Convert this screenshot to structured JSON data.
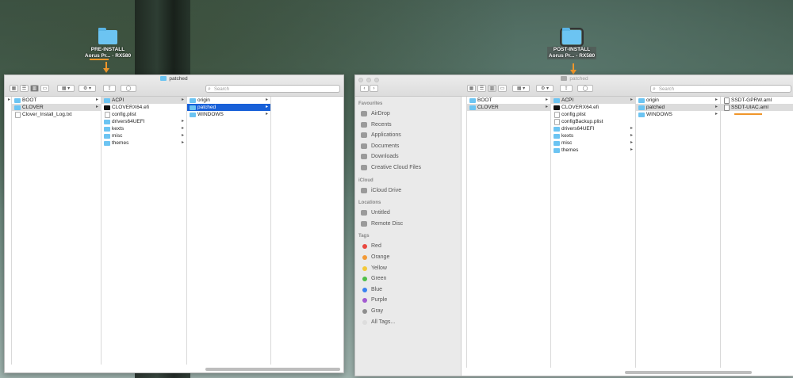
{
  "desktop": {
    "pre_icon": {
      "line1": "PRE-INSTALL",
      "line2": "Aorus Pr... - RX580"
    },
    "post_icon": {
      "line1": "POST-INSTALL",
      "line2": "Aorus Pr... - RX580"
    }
  },
  "left_window": {
    "title": "patched",
    "search_placeholder": "Search",
    "columns": [
      [
        {
          "label": "BOOT",
          "icon": "folder",
          "chev": true
        },
        {
          "label": "CLOVER",
          "icon": "folder",
          "chev": true,
          "state": "hl"
        },
        {
          "label": "Clover_Install_Log.txt",
          "icon": "doc",
          "chev": false
        }
      ],
      [
        {
          "label": "ACPI",
          "icon": "folder",
          "chev": true,
          "state": "hl"
        },
        {
          "label": "CLOVERX64.efi",
          "icon": "black",
          "chev": false
        },
        {
          "label": "config.plist",
          "icon": "doc",
          "chev": false
        },
        {
          "label": "drivers64UEFI",
          "icon": "folder",
          "chev": true
        },
        {
          "label": "kexts",
          "icon": "folder",
          "chev": true
        },
        {
          "label": "misc",
          "icon": "folder",
          "chev": true
        },
        {
          "label": "themes",
          "icon": "folder",
          "chev": true
        }
      ],
      [
        {
          "label": "origin",
          "icon": "folder",
          "chev": true
        },
        {
          "label": "patched",
          "icon": "folder",
          "chev": true,
          "state": "sel"
        },
        {
          "label": "WINDOWS",
          "icon": "folder",
          "chev": true
        }
      ]
    ]
  },
  "right_window": {
    "title": "patched",
    "search_placeholder": "Search",
    "sidebar": {
      "favorites_head": "Favourites",
      "favorites": [
        {
          "label": "AirDrop",
          "icon": "airdrop-icon"
        },
        {
          "label": "Recents",
          "icon": "clock-icon"
        },
        {
          "label": "Applications",
          "icon": "applications-icon"
        },
        {
          "label": "Documents",
          "icon": "documents-icon"
        },
        {
          "label": "Downloads",
          "icon": "downloads-icon"
        },
        {
          "label": "Creative Cloud Files",
          "icon": "folder-icon"
        }
      ],
      "icloud_head": "iCloud",
      "icloud": [
        {
          "label": "iCloud Drive",
          "icon": "cloud-icon"
        }
      ],
      "locations_head": "Locations",
      "locations": [
        {
          "label": "Untitled",
          "icon": "disk-icon"
        },
        {
          "label": "Remote Disc",
          "icon": "disc-icon"
        }
      ],
      "tags_head": "Tags",
      "tags": [
        {
          "label": "Red",
          "color": "#e9483f"
        },
        {
          "label": "Orange",
          "color": "#f39a36"
        },
        {
          "label": "Yellow",
          "color": "#f3c93a"
        },
        {
          "label": "Green",
          "color": "#4fbf4a"
        },
        {
          "label": "Blue",
          "color": "#3a82f0"
        },
        {
          "label": "Purple",
          "color": "#a35ad1"
        },
        {
          "label": "Gray",
          "color": "#8e8e8e"
        },
        {
          "label": "All Tags...",
          "color": "#dddddd"
        }
      ]
    },
    "columns": [
      [
        {
          "label": "BOOT",
          "icon": "folder",
          "chev": true
        },
        {
          "label": "CLOVER",
          "icon": "folder",
          "chev": true,
          "state": "hl"
        }
      ],
      [
        {
          "label": "ACPI",
          "icon": "folder",
          "chev": true,
          "state": "hl"
        },
        {
          "label": "CLOVERX64.efi",
          "icon": "black",
          "chev": false
        },
        {
          "label": "config.plist",
          "icon": "doc",
          "chev": false
        },
        {
          "label": "configBackup.plist",
          "icon": "doc",
          "chev": false
        },
        {
          "label": "drivers64UEFI",
          "icon": "folder",
          "chev": true
        },
        {
          "label": "kexts",
          "icon": "folder",
          "chev": true
        },
        {
          "label": "misc",
          "icon": "folder",
          "chev": true
        },
        {
          "label": "themes",
          "icon": "folder",
          "chev": true
        }
      ],
      [
        {
          "label": "origin",
          "icon": "folder",
          "chev": true
        },
        {
          "label": "patched",
          "icon": "folder",
          "chev": true,
          "state": "hl"
        },
        {
          "label": "WINDOWS",
          "icon": "folder",
          "chev": true
        }
      ],
      [
        {
          "label": "SSDT-GPRW.aml",
          "icon": "aml",
          "chev": false
        },
        {
          "label": "SSDT-UIAC.aml",
          "icon": "aml",
          "chev": false,
          "state": "hl"
        }
      ]
    ]
  },
  "colors": {
    "accent": "#f0962a",
    "selection": "#1860d8",
    "folder": "#6cc4f2"
  }
}
